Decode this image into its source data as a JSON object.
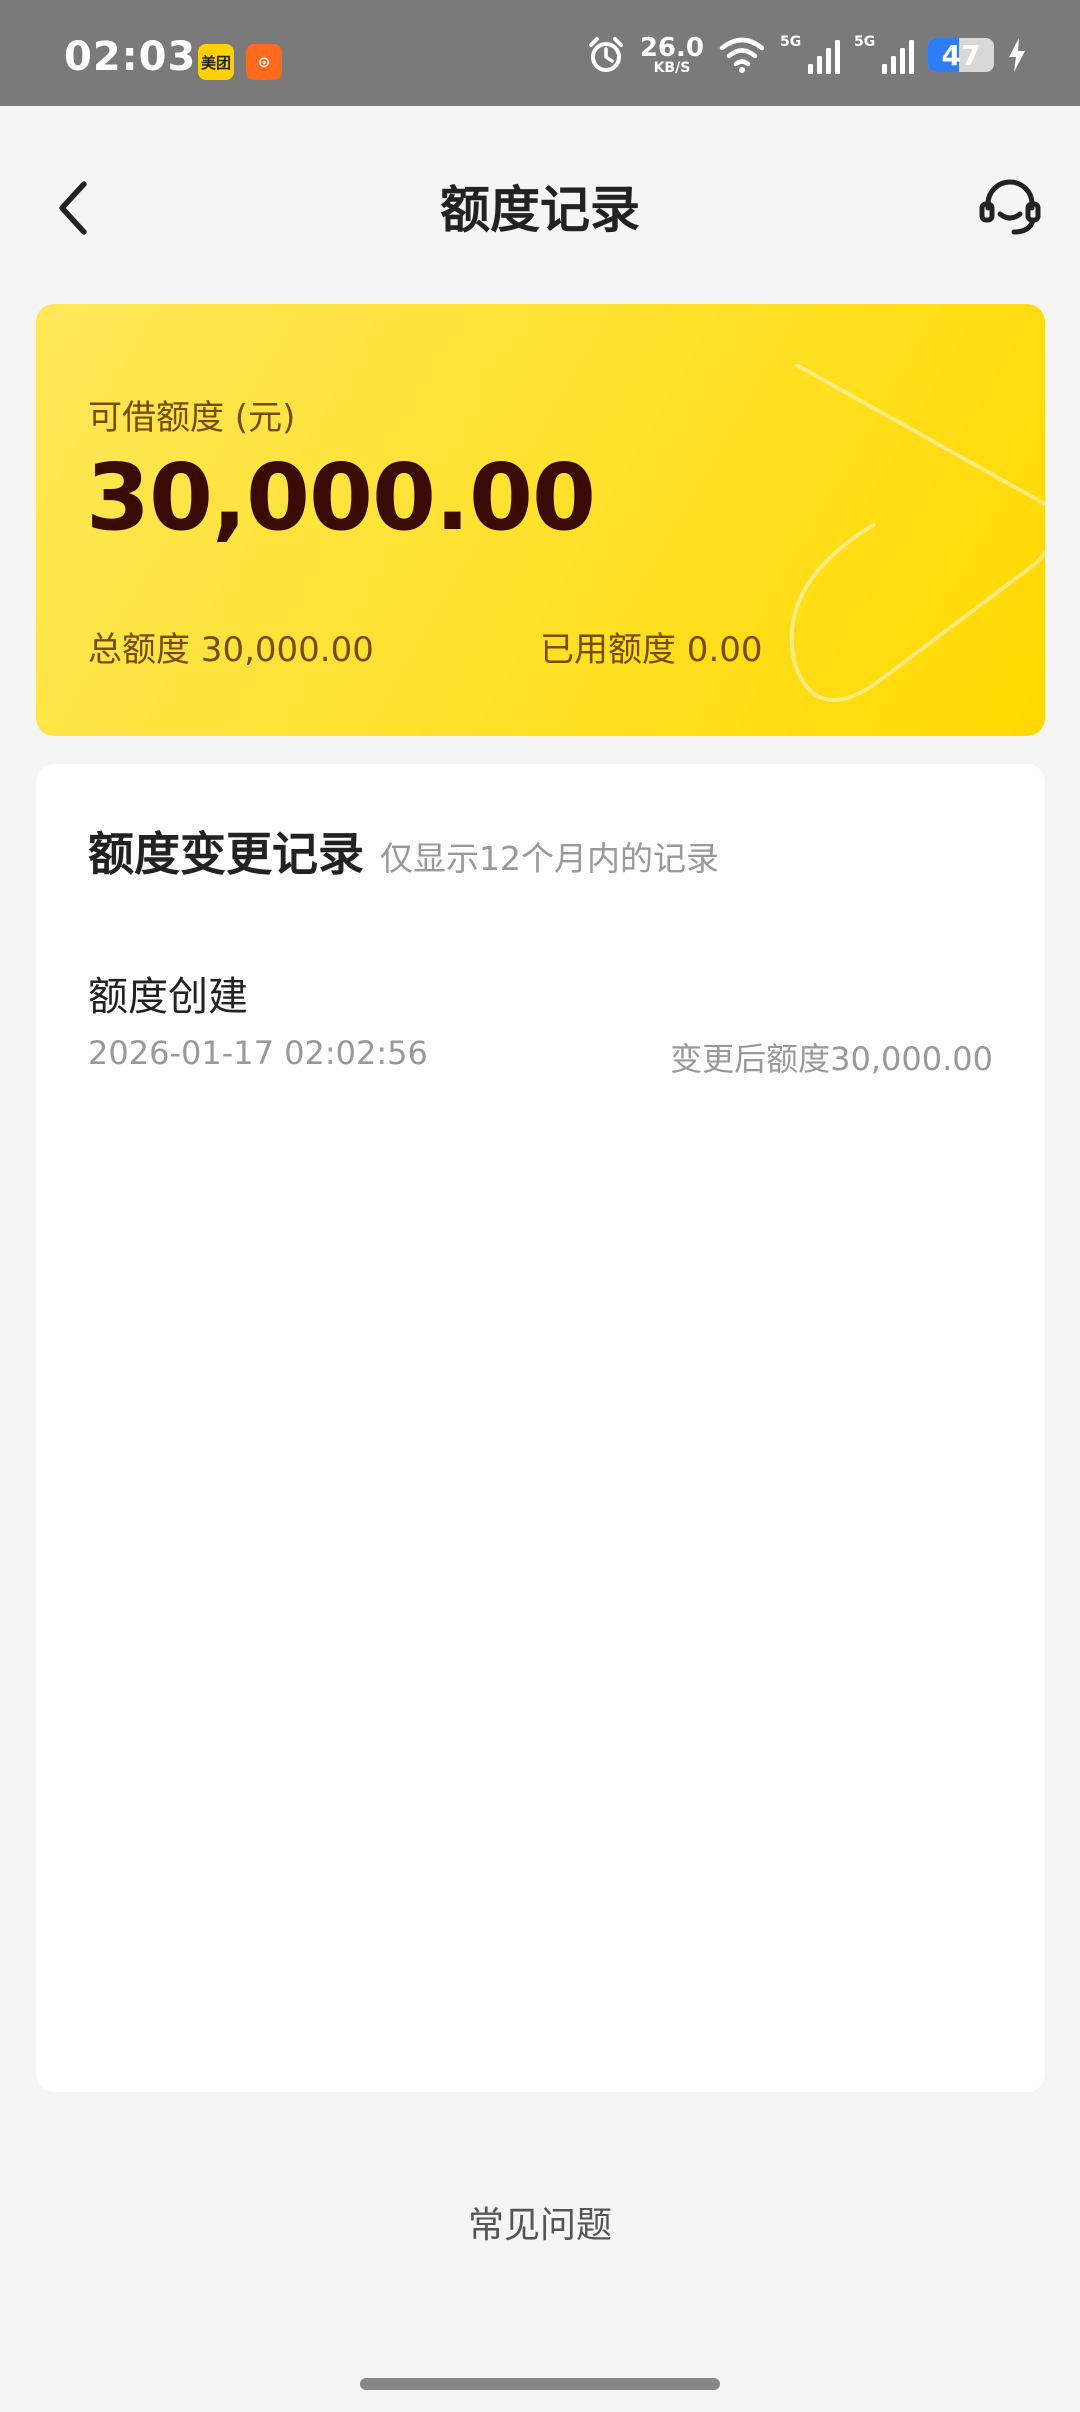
{
  "status_bar": {
    "time": "02:03",
    "app_badges": [
      "美团",
      "⊙"
    ],
    "net_speed_value": "26.0",
    "net_speed_unit": "KB/S",
    "signal_tag_1": "5G",
    "signal_tag_2": "5G",
    "battery_level": "47",
    "battery_percent": 47
  },
  "nav": {
    "title": "额度记录",
    "back_icon": "chevron-left-icon",
    "service_icon": "headset-icon"
  },
  "quota_card": {
    "label": "可借额度 (元)",
    "amount": "30,000.00",
    "total": "总额度 30,000.00",
    "used": "已用额度 0.00"
  },
  "records": {
    "title": "额度变更记录",
    "note": "仅显示12个月内的记录",
    "items": [
      {
        "name": "额度创建",
        "time": "2026-01-17 02:02:56",
        "after": "变更后额度30,000.00"
      }
    ]
  },
  "footer": {
    "faq": "常见问题"
  },
  "colors": {
    "card_yellow": "#ffe232",
    "amount_dark": "#3a0a05",
    "label_brown": "#7a4a00",
    "page_bg": "#f5f5f5"
  }
}
